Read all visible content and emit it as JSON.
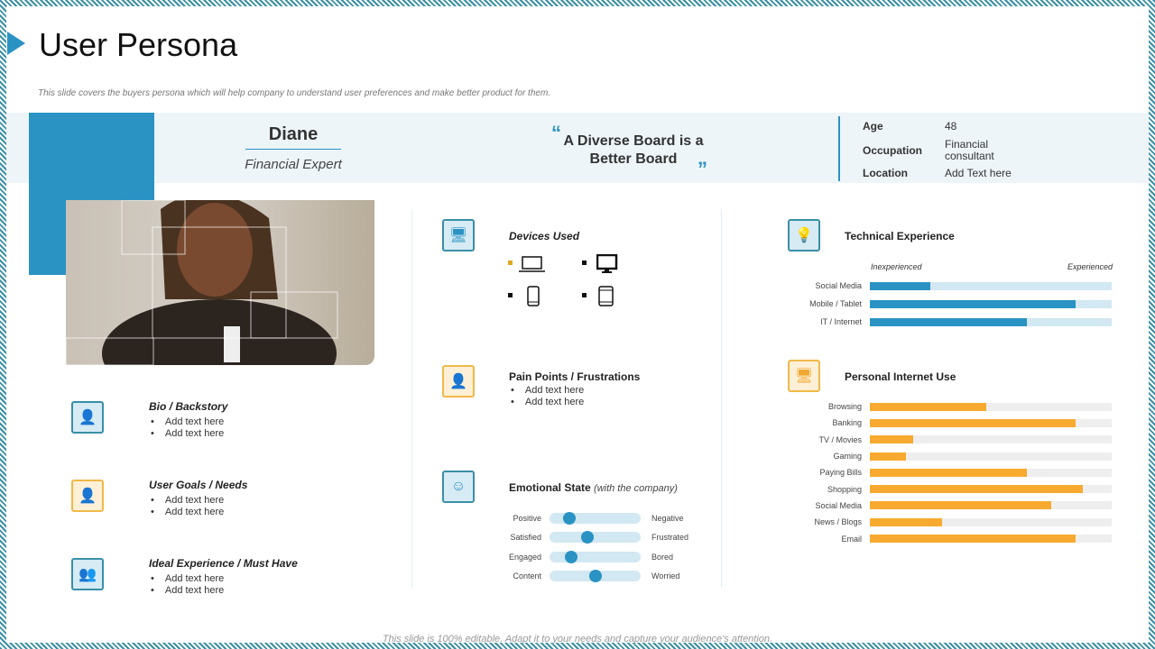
{
  "title": "User Persona",
  "subtitle": "This slide covers the buyers persona which will help company to understand user preferences and make better product for them.",
  "persona": {
    "name": "Diane",
    "role": "Financial Expert",
    "quote": "A Diverse Board is a Better Board",
    "info": [
      {
        "label": "Age",
        "value": "48"
      },
      {
        "label": "Occupation",
        "value": "Financial consultant"
      },
      {
        "label": "Location",
        "value": "Add Text here"
      }
    ]
  },
  "bio": {
    "title": "Bio / Backstory",
    "items": [
      "Add text here",
      "Add text here"
    ]
  },
  "goals": {
    "title": "User Goals / Needs",
    "items": [
      "Add text here",
      "Add text here"
    ]
  },
  "ideal": {
    "title": "Ideal Experience / Must Have",
    "items": [
      "Add text here",
      "Add text here"
    ]
  },
  "devices": {
    "title": "Devices Used",
    "items": [
      "laptop-icon",
      "desktop-icon",
      "phone-icon",
      "tablet-icon"
    ]
  },
  "pain": {
    "title": "Pain Points / Frustrations",
    "items": [
      "Add text here",
      "Add text here"
    ]
  },
  "emotional": {
    "title": "Emotional  State",
    "subtitle": "(with the company)",
    "rows": [
      {
        "left": "Positive",
        "right": "Negative",
        "value": 0.22
      },
      {
        "left": "Satisfied",
        "right": "Frustrated",
        "value": 0.42
      },
      {
        "left": "Engaged",
        "right": "Bored",
        "value": 0.24
      },
      {
        "left": "Content",
        "right": "Worried",
        "value": 0.5
      }
    ]
  },
  "technical": {
    "title": "Technical Experience",
    "min_label": "Inexperienced",
    "max_label": "Experienced",
    "rows": [
      {
        "label": "Social Media",
        "value": 0.25
      },
      {
        "label": "Mobile / Tablet",
        "value": 0.85
      },
      {
        "label": "IT / Internet",
        "value": 0.65
      }
    ]
  },
  "internet": {
    "title": "Personal Internet Use",
    "rows": [
      {
        "label": "Browsing",
        "value": 0.48
      },
      {
        "label": "Banking",
        "value": 0.85
      },
      {
        "label": "TV  / Movies",
        "value": 0.18
      },
      {
        "label": "Gaming",
        "value": 0.15
      },
      {
        "label": "Paying Bills",
        "value": 0.65
      },
      {
        "label": "Shopping",
        "value": 0.88
      },
      {
        "label": "Social Media",
        "value": 0.75
      },
      {
        "label": "News / Blogs",
        "value": 0.3
      },
      {
        "label": "Email",
        "value": 0.85
      }
    ]
  },
  "footer": "This slide is 100% editable. Adapt it to your needs and capture your audience's attention.",
  "colors": {
    "blue": "#2a93c4",
    "orange": "#f7aa2f"
  }
}
